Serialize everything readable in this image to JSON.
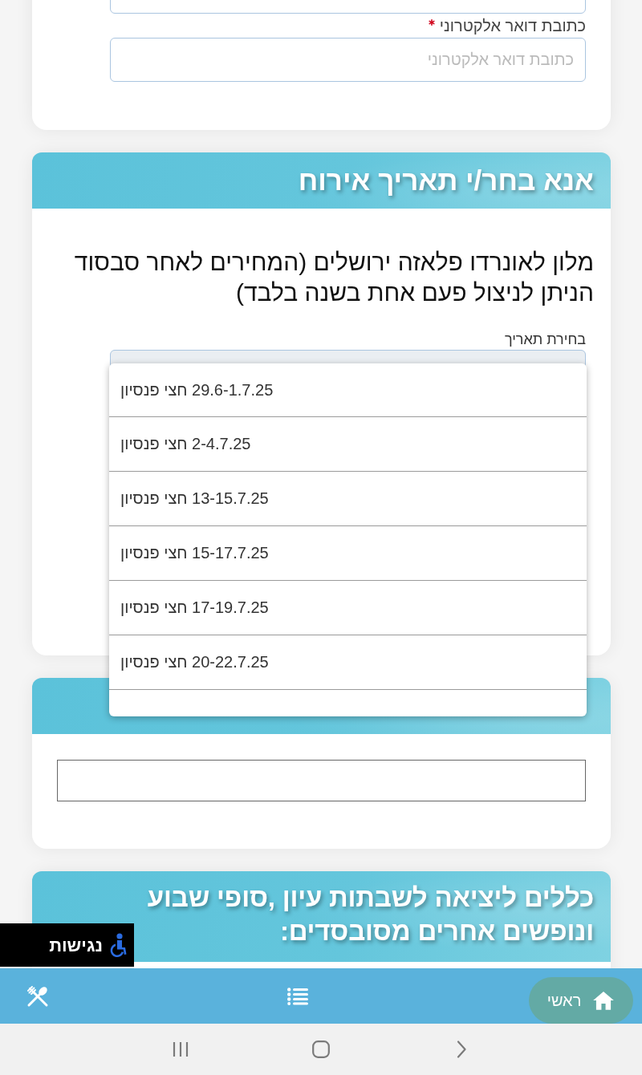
{
  "contact_form": {
    "fields": [
      {
        "label": "כתובת דואר אלקטרוני",
        "required": true,
        "placeholder": "כתובת דואר אלקטרוני"
      }
    ]
  },
  "date_section": {
    "title": "אנא בחר/י תאריך אירוח",
    "description": "מלון לאונרדו פלאזה ירושלים (המחירים לאחר סבסוד הניתן לניצול פעם אחת בשנה בלבד)",
    "date_select": {
      "label": "בחירת תאריך",
      "options": [
        {
          "label": "29.6-1.7.25 חצי פנסיון",
          "selected": false
        },
        {
          "label": "2-4.7.25 חצי פנסיון",
          "selected": false
        },
        {
          "label": "13-15.7.25 חצי פנסיון",
          "selected": false
        },
        {
          "label": "15-17.7.25 חצי פנסיון",
          "selected": false
        },
        {
          "label": "17-19.7.25 חצי פנסיון",
          "selected": false
        },
        {
          "label": "20-22.7.25 חצי פנסיון",
          "selected": false
        }
      ]
    }
  },
  "rules_section": {
    "title": "כללים ליציאה לשבתות עיון ,סופי שבוע ונופשים אחרים מסובסדים:"
  },
  "accessibility_button": {
    "label": "נגישות"
  },
  "bottom_nav": {
    "items": [
      {
        "kind": "home",
        "label": "ראשי",
        "selected": true
      },
      {
        "kind": "list",
        "selected": false
      },
      {
        "kind": "dining",
        "selected": false
      }
    ]
  },
  "system_nav": {
    "items": [
      {
        "kind": "recents"
      },
      {
        "kind": "home"
      },
      {
        "kind": "back"
      }
    ]
  }
}
